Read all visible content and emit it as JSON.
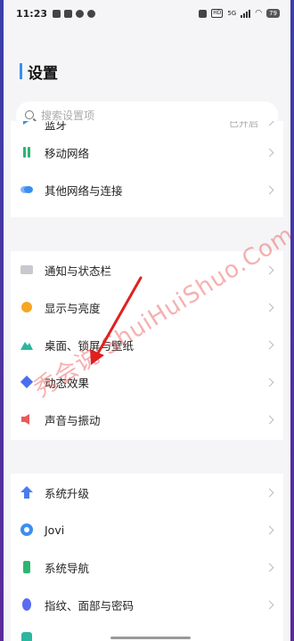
{
  "status_bar": {
    "time": "11:23",
    "network_label": "5G",
    "hd_label": "HD",
    "battery": "79"
  },
  "header": {
    "title": "设置"
  },
  "search": {
    "placeholder": "搜索设置项"
  },
  "group1": {
    "partial_item": {
      "label": "蓝牙",
      "value": "已开启",
      "icon": "bluetooth-icon"
    },
    "items": [
      {
        "label": "移动网络",
        "icon": "mobile-network-icon",
        "color": "#2bb673"
      },
      {
        "label": "其他网络与连接",
        "icon": "connections-icon",
        "color": "#3b8ef0"
      }
    ]
  },
  "group2": {
    "items": [
      {
        "label": "通知与状态栏",
        "icon": "notification-icon",
        "color": "#b8b8c0"
      },
      {
        "label": "显示与亮度",
        "icon": "display-icon",
        "color": "#f5a623"
      },
      {
        "label": "桌面、锁屏与壁纸",
        "icon": "wallpaper-icon",
        "color": "#2bb6a0"
      },
      {
        "label": "动态效果",
        "icon": "animation-icon",
        "color": "#4a6cf0"
      },
      {
        "label": "声音与振动",
        "icon": "sound-icon",
        "color": "#e85a5a"
      }
    ]
  },
  "group3": {
    "items": [
      {
        "label": "系统升级",
        "icon": "system-update-icon",
        "color": "#4a7cf0"
      },
      {
        "label": "Jovi",
        "icon": "jovi-icon",
        "color": "#3b8ef0"
      },
      {
        "label": "系统导航",
        "icon": "navigation-icon",
        "color": "#2bb673"
      },
      {
        "label": "指纹、面部与密码",
        "icon": "fingerprint-icon",
        "color": "#5a6cf0"
      }
    ]
  },
  "watermark": {
    "text": "秀会说 ShuiHuiShuo.Com",
    "color": "#eb5050"
  }
}
